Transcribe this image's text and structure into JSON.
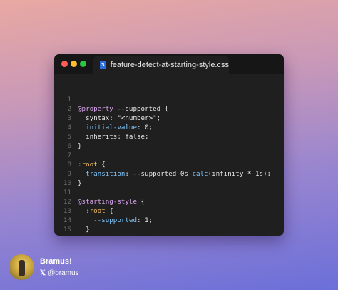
{
  "window": {
    "tab_title": "feature-detect-at-starting-style.css",
    "tab_icon_glyph": "3"
  },
  "code": {
    "line_numbers": [
      "1",
      "2",
      "3",
      "4",
      "5",
      "6",
      "7",
      "8",
      "9",
      "10",
      "11",
      "12",
      "13",
      "14",
      "15"
    ],
    "l1": {
      "a": "@property",
      "b": " --supported {"
    },
    "l2": {
      "a": "  syntax",
      "b": ": \"<number>\";"
    },
    "l3": {
      "a": "  initial-value",
      "b": ": 0;"
    },
    "l4": {
      "a": "  inherits",
      "b": ": false;"
    },
    "l5": {
      "a": "}"
    },
    "l6": {
      "a": ""
    },
    "l7": {
      "a": ":root",
      "b": " {"
    },
    "l8": {
      "a": "  transition",
      "b": ": --supported 0s ",
      "c": "calc",
      "d": "(infinity * 1s);"
    },
    "l9": {
      "a": "}"
    },
    "l10": {
      "a": ""
    },
    "l11": {
      "a": "@starting-style",
      "b": " {"
    },
    "l12": {
      "a": "  :root",
      "b": " {"
    },
    "l13": {
      "a": "    --supported",
      "b": ": 1;"
    },
    "l14": {
      "a": "  }"
    },
    "l15": {
      "a": "}"
    }
  },
  "author": {
    "name": "Bramus!",
    "handle": "@bramus",
    "platform_icon": "x-logo-icon"
  },
  "colors": {
    "window_bg": "#1f1f1f",
    "titlebar_bg": "#161616",
    "at_rule": "#d9a3f0",
    "property": "#7ec7ff",
    "selector": "#f0b860",
    "text": "#e6e6e6",
    "line_number": "#6c6c6c"
  }
}
